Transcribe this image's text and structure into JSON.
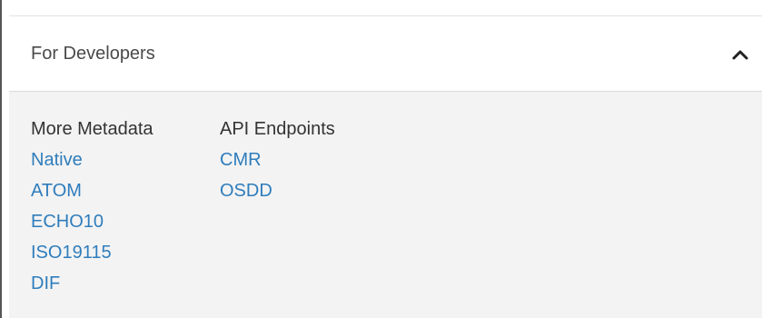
{
  "developers_panel": {
    "title": "For Developers",
    "toggle_icon": "chevron-up-icon",
    "expanded": true,
    "colors": {
      "header_bg": "#ffffff",
      "body_bg": "#f3f3f3",
      "link": "#2f7dbc",
      "heading": "#333333",
      "title": "#4a4a4a"
    },
    "more_metadata": {
      "heading": "More Metadata",
      "links": [
        {
          "label": "Native"
        },
        {
          "label": "ATOM"
        },
        {
          "label": "ECHO10"
        },
        {
          "label": "ISO19115"
        },
        {
          "label": "DIF"
        }
      ]
    },
    "api_endpoints": {
      "heading": "API Endpoints",
      "links": [
        {
          "label": "CMR"
        },
        {
          "label": "OSDD"
        }
      ]
    }
  }
}
